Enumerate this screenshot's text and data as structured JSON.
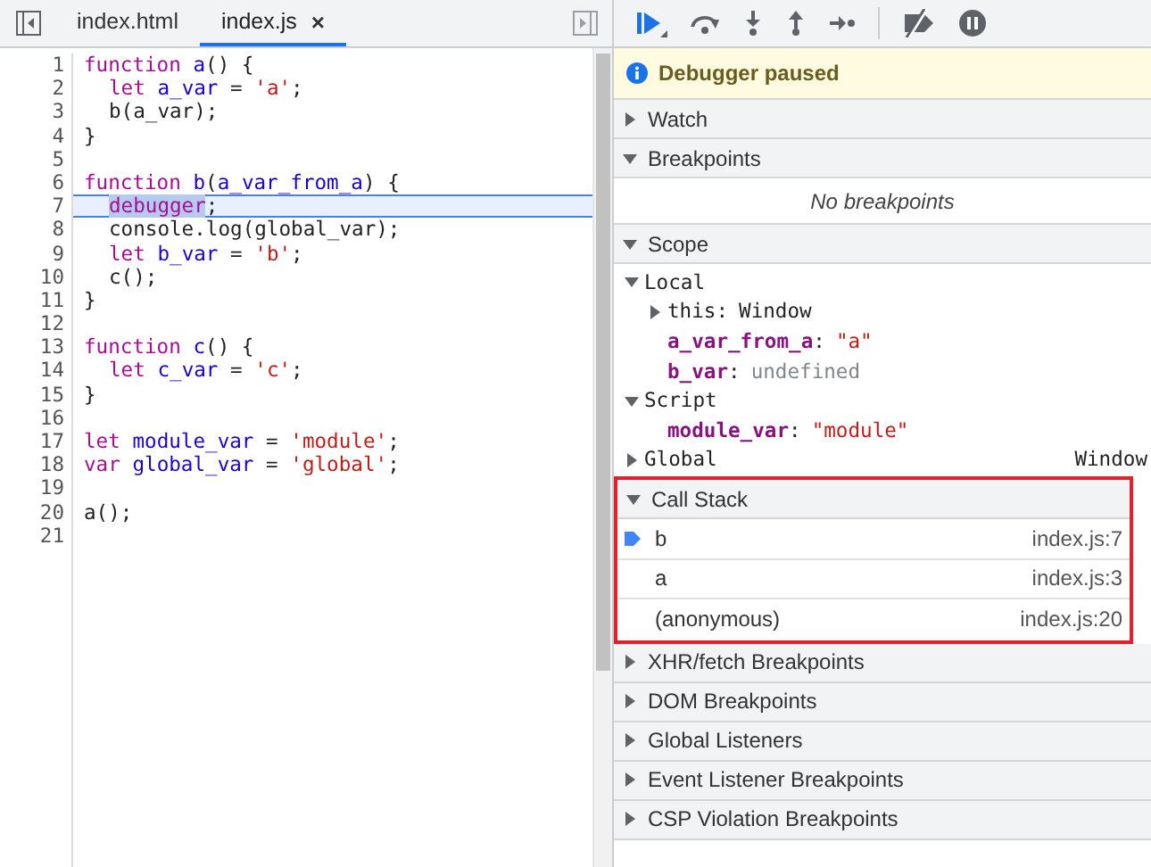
{
  "editor": {
    "tabs": [
      {
        "label": "index.html",
        "selected": false
      },
      {
        "label": "index.js",
        "selected": true,
        "close": "×"
      }
    ],
    "lines": [
      {
        "n": "1",
        "tokens": [
          {
            "t": "function ",
            "kind": "kw"
          },
          {
            "t": "a",
            "kind": "def"
          },
          {
            "t": "() {",
            "kind": "plain"
          }
        ]
      },
      {
        "n": "2",
        "indent": true,
        "tokens": [
          {
            "t": "let ",
            "kind": "kw"
          },
          {
            "t": "a_var",
            "kind": "def"
          },
          {
            "t": " = ",
            "kind": "plain"
          },
          {
            "t": "'a'",
            "kind": "str"
          },
          {
            "t": ";",
            "kind": "plain"
          }
        ]
      },
      {
        "n": "3",
        "indent": true,
        "tokens": [
          {
            "t": "b(a_var);",
            "kind": "plain"
          }
        ]
      },
      {
        "n": "4",
        "tokens": [
          {
            "t": "}",
            "kind": "plain"
          }
        ]
      },
      {
        "n": "5"
      },
      {
        "n": "6",
        "tokens": [
          {
            "t": "function ",
            "kind": "kw"
          },
          {
            "t": "b",
            "kind": "def"
          },
          {
            "t": "(",
            "kind": "plain"
          },
          {
            "t": "a_var_from_a",
            "kind": "def"
          },
          {
            "t": ") {",
            "kind": "plain"
          }
        ]
      },
      {
        "n": "7",
        "current": true,
        "indent": true,
        "tokens": [
          {
            "t": "debugger",
            "kind": "kw",
            "selected": true
          },
          {
            "t": ";",
            "kind": "plain"
          }
        ]
      },
      {
        "n": "8",
        "indent": true,
        "tokens": [
          {
            "t": "console.log(global_var);",
            "kind": "plain"
          }
        ]
      },
      {
        "n": "9",
        "indent": true,
        "tokens": [
          {
            "t": "let ",
            "kind": "kw"
          },
          {
            "t": "b_var",
            "kind": "def"
          },
          {
            "t": " = ",
            "kind": "plain"
          },
          {
            "t": "'b'",
            "kind": "str"
          },
          {
            "t": ";",
            "kind": "plain"
          }
        ]
      },
      {
        "n": "10",
        "indent": true,
        "tokens": [
          {
            "t": "c();",
            "kind": "plain"
          }
        ]
      },
      {
        "n": "11",
        "tokens": [
          {
            "t": "}",
            "kind": "plain"
          }
        ]
      },
      {
        "n": "12"
      },
      {
        "n": "13",
        "tokens": [
          {
            "t": "function ",
            "kind": "kw"
          },
          {
            "t": "c",
            "kind": "def"
          },
          {
            "t": "() {",
            "kind": "plain"
          }
        ]
      },
      {
        "n": "14",
        "indent": true,
        "tokens": [
          {
            "t": "let ",
            "kind": "kw"
          },
          {
            "t": "c_var",
            "kind": "def"
          },
          {
            "t": " = ",
            "kind": "plain"
          },
          {
            "t": "'c'",
            "kind": "str"
          },
          {
            "t": ";",
            "kind": "plain"
          }
        ]
      },
      {
        "n": "15",
        "tokens": [
          {
            "t": "}",
            "kind": "plain"
          }
        ]
      },
      {
        "n": "16"
      },
      {
        "n": "17",
        "tokens": [
          {
            "t": "let ",
            "kind": "kw"
          },
          {
            "t": "module_var",
            "kind": "def"
          },
          {
            "t": " = ",
            "kind": "plain"
          },
          {
            "t": "'module'",
            "kind": "str"
          },
          {
            "t": ";",
            "kind": "plain"
          }
        ]
      },
      {
        "n": "18",
        "tokens": [
          {
            "t": "var ",
            "kind": "kw"
          },
          {
            "t": "global_var",
            "kind": "def"
          },
          {
            "t": " = ",
            "kind": "plain"
          },
          {
            "t": "'global'",
            "kind": "str"
          },
          {
            "t": ";",
            "kind": "plain"
          }
        ]
      },
      {
        "n": "19"
      },
      {
        "n": "20",
        "tokens": [
          {
            "t": "a();",
            "kind": "plain"
          }
        ]
      },
      {
        "n": "21"
      }
    ]
  },
  "debugger": {
    "status": "Debugger paused",
    "sections": [
      {
        "title": "Watch",
        "expanded": false
      },
      {
        "title": "Breakpoints",
        "expanded": true,
        "message": "No breakpoints"
      },
      {
        "title": "Scope",
        "expanded": true,
        "tree": [
          {
            "name": "Local",
            "kind": "scope",
            "expanded": true,
            "children": [
              {
                "name": "this",
                "colon": ":",
                "kind": "object",
                "expanded": false,
                "value": "Window"
              },
              {
                "name": "a_var_from_a",
                "colon": ":",
                "kind": "string",
                "value": "\"a\""
              },
              {
                "name": "b_var",
                "colon": ":",
                "kind": "undefined",
                "value": "undefined"
              }
            ]
          },
          {
            "name": "Script",
            "kind": "scope",
            "expanded": true,
            "children": [
              {
                "name": "module_var",
                "colon": ":",
                "kind": "string",
                "value": "\"module\""
              }
            ]
          },
          {
            "name": "Global",
            "kind": "scope",
            "expanded": false,
            "value": "Window"
          }
        ]
      },
      {
        "title": "Call Stack",
        "expanded": true,
        "highlighted": true,
        "frames": [
          {
            "name": "b",
            "location": "index.js:7",
            "selected": true
          },
          {
            "name": "a",
            "location": "index.js:3",
            "selected": false
          },
          {
            "name": "(anonymous)",
            "location": "index.js:20",
            "selected": false
          }
        ]
      },
      {
        "title": "XHR/fetch Breakpoints",
        "expanded": false
      },
      {
        "title": "DOM Breakpoints",
        "expanded": false
      },
      {
        "title": "Global Listeners",
        "expanded": false
      },
      {
        "title": "Event Listener Breakpoints",
        "expanded": false
      },
      {
        "title": "CSP Violation Breakpoints",
        "expanded": false
      }
    ]
  }
}
